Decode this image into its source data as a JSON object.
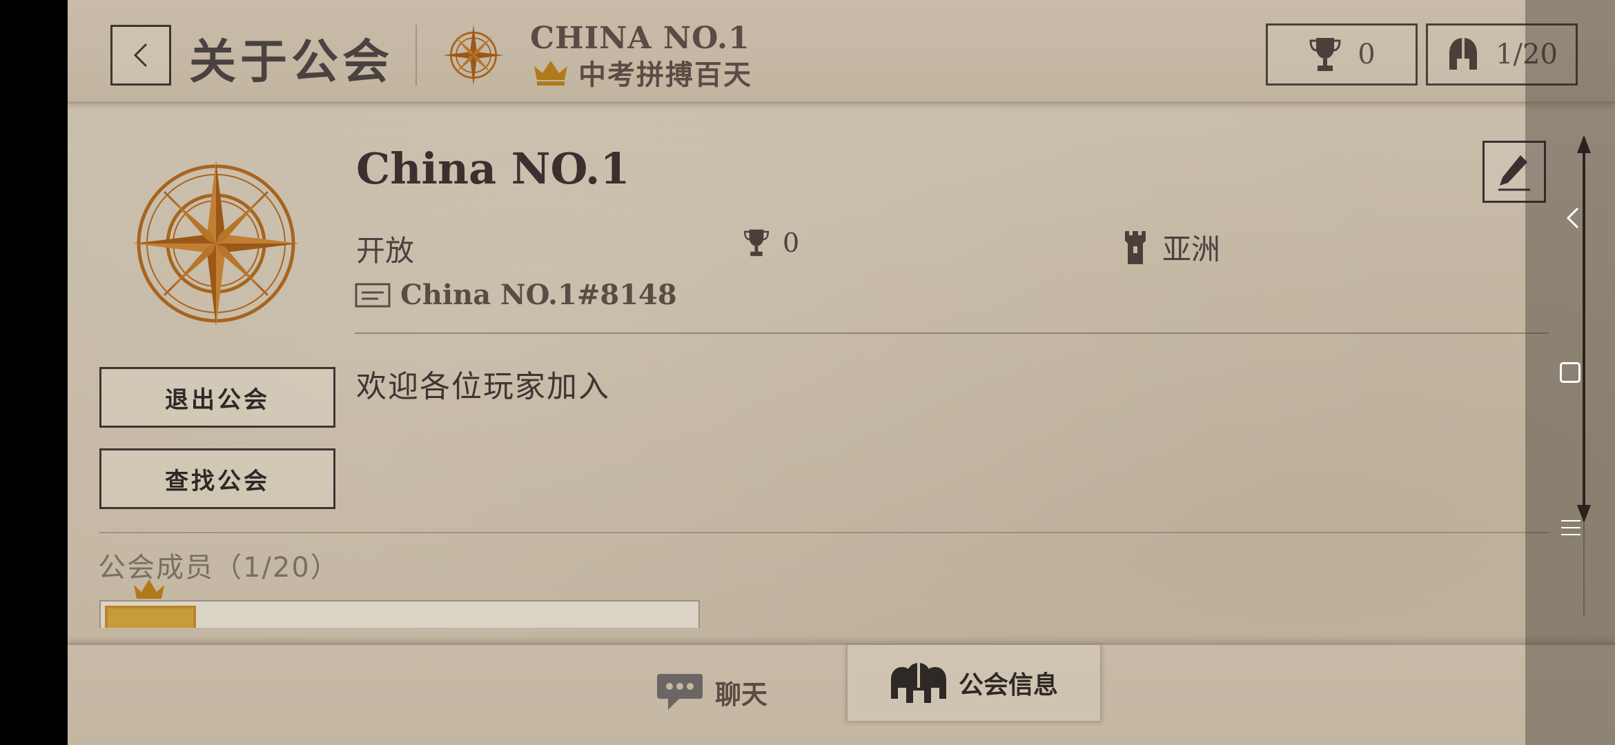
{
  "header": {
    "title": "关于公会",
    "guild_name": "CHINA NO.1",
    "guild_motto": "中考拼搏百天",
    "trophy_count": "0",
    "member_count": "1/20"
  },
  "guild": {
    "name": "China NO.1",
    "status": "开放",
    "trophies": "0",
    "region": "亚洲",
    "id": "China NO.1#8148",
    "description": "欢迎各位玩家加入"
  },
  "buttons": {
    "leave": "退出公会",
    "find": "查找公会"
  },
  "members": {
    "title": "公会成员（1/20）"
  },
  "tabs": {
    "chat": "聊天",
    "guild_info": "公会信息"
  },
  "colors": {
    "parchment": "#c6baa6",
    "ink": "#3a3030",
    "emblem_gold": "#a8641e"
  }
}
